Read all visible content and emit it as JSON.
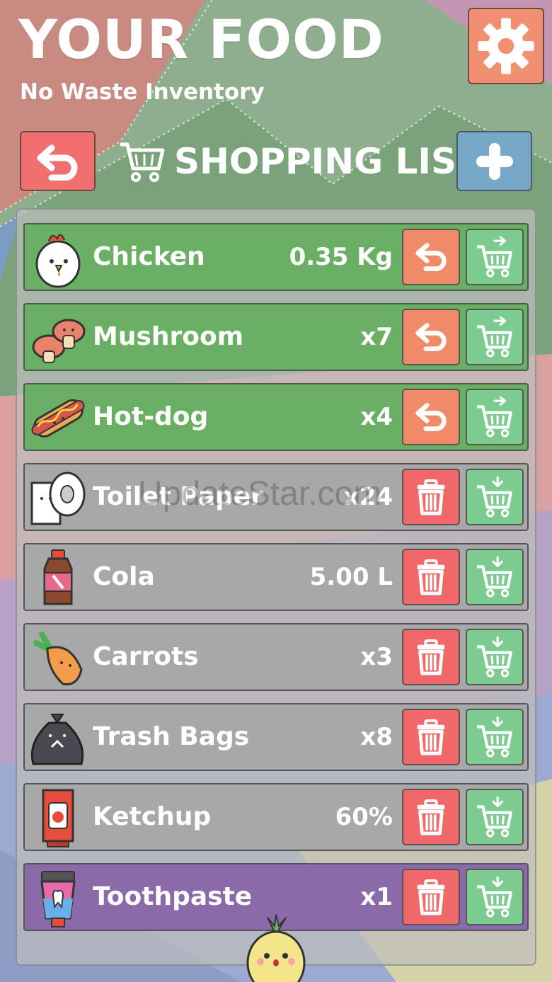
{
  "header": {
    "title": "YOUR FOOD",
    "subtitle": "No Waste Inventory"
  },
  "toolbar": {
    "heading": "SHOPPING LIST",
    "settings_icon": "gear-icon",
    "back_icon": "undo-icon",
    "add_icon": "plus-icon"
  },
  "colors": {
    "bought_row": "#6ab064",
    "pending_row": "#a8a8a8",
    "selected_row": "#8a6aa8",
    "undo_button": "#f08a68",
    "delete_button": "#f06868",
    "cart_button": "#7ccc90",
    "settings_button": "#f09070",
    "add_button": "#78a8c8"
  },
  "items": [
    {
      "name": "Chicken",
      "qty": "0.35 Kg",
      "state": "bought",
      "icon": "chicken-icon"
    },
    {
      "name": "Mushroom",
      "qty": "x7",
      "state": "bought",
      "icon": "mushroom-icon"
    },
    {
      "name": "Hot-dog",
      "qty": "x4",
      "state": "bought",
      "icon": "hotdog-icon"
    },
    {
      "name": "Toilet Paper",
      "qty": "x24",
      "state": "pending",
      "icon": "toilet-paper-icon"
    },
    {
      "name": "Cola",
      "qty": "5.00 L",
      "state": "pending",
      "icon": "cola-bottle-icon"
    },
    {
      "name": "Carrots",
      "qty": "x3",
      "state": "pending",
      "icon": "carrot-icon"
    },
    {
      "name": "Trash Bags",
      "qty": "x8",
      "state": "pending",
      "icon": "trash-bag-icon"
    },
    {
      "name": "Ketchup",
      "qty": "60%",
      "state": "pending",
      "icon": "ketchup-icon"
    },
    {
      "name": "Toothpaste",
      "qty": "x1",
      "state": "selected",
      "icon": "toothpaste-icon"
    }
  ],
  "watermark": "UpdateStar.com"
}
